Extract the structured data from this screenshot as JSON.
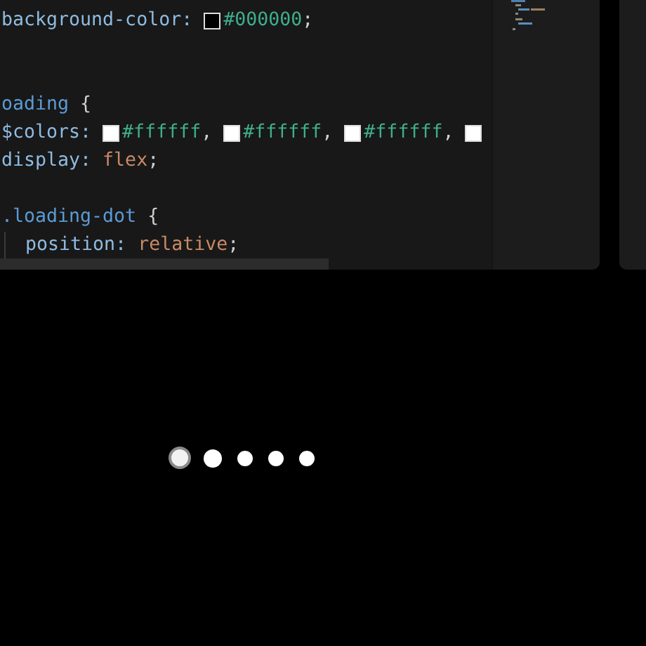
{
  "editor": {
    "lines": [
      {
        "kind": "code",
        "tokens": [
          {
            "kind": "property",
            "text": "background-color:"
          },
          {
            "kind": "swatch",
            "color": "#000000"
          },
          {
            "kind": "hex",
            "text": "#000000"
          },
          {
            "kind": "punct",
            "text": ";"
          }
        ]
      },
      {
        "kind": "blank"
      },
      {
        "kind": "blank"
      },
      {
        "kind": "code",
        "tokens": [
          {
            "kind": "selector",
            "text": "oading"
          },
          {
            "kind": "punct",
            "text": " {"
          }
        ]
      },
      {
        "kind": "code",
        "tokens": [
          {
            "kind": "property",
            "text": "$colors:"
          },
          {
            "kind": "swatch",
            "color": "#ffffff"
          },
          {
            "kind": "hex",
            "text": "#ffffff"
          },
          {
            "kind": "punct",
            "text": ","
          },
          {
            "kind": "swatch",
            "color": "#ffffff"
          },
          {
            "kind": "hex",
            "text": "#ffffff"
          },
          {
            "kind": "punct",
            "text": ","
          },
          {
            "kind": "swatch",
            "color": "#ffffff"
          },
          {
            "kind": "hex",
            "text": "#ffffff"
          },
          {
            "kind": "punct",
            "text": ","
          },
          {
            "kind": "swatch",
            "color": "#ffffff"
          }
        ]
      },
      {
        "kind": "code",
        "tokens": [
          {
            "kind": "property",
            "text": "display:"
          },
          {
            "kind": "value",
            "text": "flex"
          },
          {
            "kind": "punct",
            "text": ";"
          }
        ]
      },
      {
        "kind": "blank"
      },
      {
        "kind": "code",
        "tokens": [
          {
            "kind": "selector",
            "text": ".loading-dot"
          },
          {
            "kind": "punct",
            "text": " {"
          }
        ],
        "children": [
          {
            "kind": "code",
            "tokens": [
              {
                "kind": "property",
                "text": "position:"
              },
              {
                "kind": "value",
                "text": "relative"
              },
              {
                "kind": "punct",
                "text": ";"
              }
            ]
          }
        ]
      }
    ]
  },
  "preview": {
    "dots": [
      {
        "kind": "ring"
      },
      {
        "kind": "large"
      },
      {
        "kind": "small"
      },
      {
        "kind": "small"
      },
      {
        "kind": "small"
      }
    ]
  }
}
